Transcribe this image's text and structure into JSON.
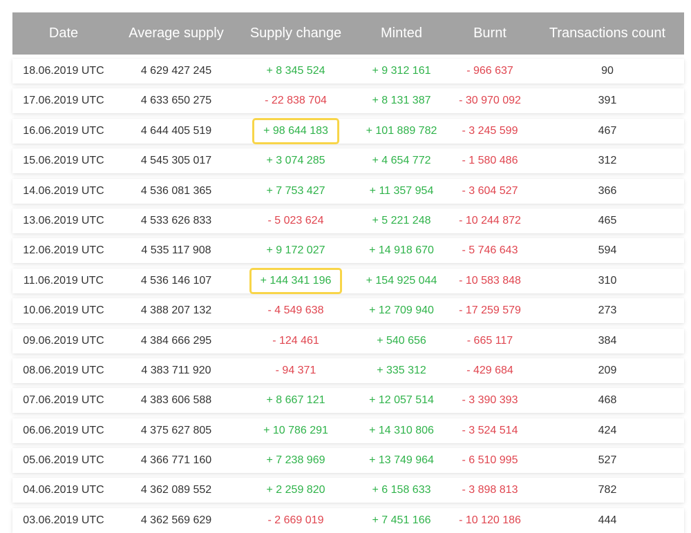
{
  "table": {
    "headers": [
      "Date",
      "Average supply",
      "Supply change",
      "Minted",
      "Burnt",
      "Transactions count"
    ],
    "rows": [
      {
        "date": "18.06.2019 UTC",
        "average_supply": "4 629 427 245",
        "supply_change": "+ 8 345 524",
        "minted": "+ 9 312 161",
        "burnt": "- 966 637",
        "tx_count": "90"
      },
      {
        "date": "17.06.2019 UTC",
        "average_supply": "4 633 650 275",
        "supply_change": "- 22 838 704",
        "minted": "+ 8 131 387",
        "burnt": "- 30 970 092",
        "tx_count": "391"
      },
      {
        "date": "16.06.2019 UTC",
        "average_supply": "4 644 405 519",
        "supply_change": "+ 98 644 183",
        "minted": "+ 101 889 782",
        "burnt": "- 3 245 599",
        "tx_count": "467"
      },
      {
        "date": "15.06.2019 UTC",
        "average_supply": "4 545 305 017",
        "supply_change": "+ 3 074 285",
        "minted": "+ 4 654 772",
        "burnt": "- 1 580 486",
        "tx_count": "312"
      },
      {
        "date": "14.06.2019 UTC",
        "average_supply": "4 536 081 365",
        "supply_change": "+ 7 753 427",
        "minted": "+ 11 357 954",
        "burnt": "- 3 604 527",
        "tx_count": "366"
      },
      {
        "date": "13.06.2019 UTC",
        "average_supply": "4 533 626 833",
        "supply_change": "- 5 023 624",
        "minted": "+ 5 221 248",
        "burnt": "- 10 244 872",
        "tx_count": "465"
      },
      {
        "date": "12.06.2019 UTC",
        "average_supply": "4 535 117 908",
        "supply_change": "+ 9 172 027",
        "minted": "+ 14 918 670",
        "burnt": "- 5 746 643",
        "tx_count": "594"
      },
      {
        "date": "11.06.2019 UTC",
        "average_supply": "4 536 146 107",
        "supply_change": "+ 144 341 196",
        "minted": "+ 154 925 044",
        "burnt": "- 10 583 848",
        "tx_count": "310"
      },
      {
        "date": "10.06.2019 UTC",
        "average_supply": "4 388 207 132",
        "supply_change": "- 4 549 638",
        "minted": "+ 12 709 940",
        "burnt": "- 17 259 579",
        "tx_count": "273"
      },
      {
        "date": "09.06.2019 UTC",
        "average_supply": "4 384 666 295",
        "supply_change": "- 124 461",
        "minted": "+ 540 656",
        "burnt": "- 665 117",
        "tx_count": "384"
      },
      {
        "date": "08.06.2019 UTC",
        "average_supply": "4 383 711 920",
        "supply_change": "- 94 371",
        "minted": "+ 335 312",
        "burnt": "- 429 684",
        "tx_count": "209"
      },
      {
        "date": "07.06.2019 UTC",
        "average_supply": "4 383 606 588",
        "supply_change": "+ 8 667 121",
        "minted": "+ 12 057 514",
        "burnt": "- 3 390 393",
        "tx_count": "468"
      },
      {
        "date": "06.06.2019 UTC",
        "average_supply": "4 375 627 805",
        "supply_change": "+ 10 786 291",
        "minted": "+ 14 310 806",
        "burnt": "- 3 524 514",
        "tx_count": "424"
      },
      {
        "date": "05.06.2019 UTC",
        "average_supply": "4 366 771 160",
        "supply_change": "+ 7 238 969",
        "minted": "+ 13 749 964",
        "burnt": "- 6 510 995",
        "tx_count": "527"
      },
      {
        "date": "04.06.2019 UTC",
        "average_supply": "4 362 089 552",
        "supply_change": "+ 2 259 820",
        "minted": "+ 6 158 633",
        "burnt": "- 3 898 813",
        "tx_count": "782"
      },
      {
        "date": "03.06.2019 UTC",
        "average_supply": "4 362 569 629",
        "supply_change": "- 2 669 019",
        "minted": "+ 7 451 166",
        "burnt": "- 10 120 186",
        "tx_count": "444"
      }
    ],
    "highlighted_supply_change_rows": [
      2,
      7
    ]
  },
  "colors": {
    "header_bg": "#a3a3a3",
    "positive": "#2fb34a",
    "negative": "#e0454f",
    "highlight_border": "#f8d549"
  }
}
